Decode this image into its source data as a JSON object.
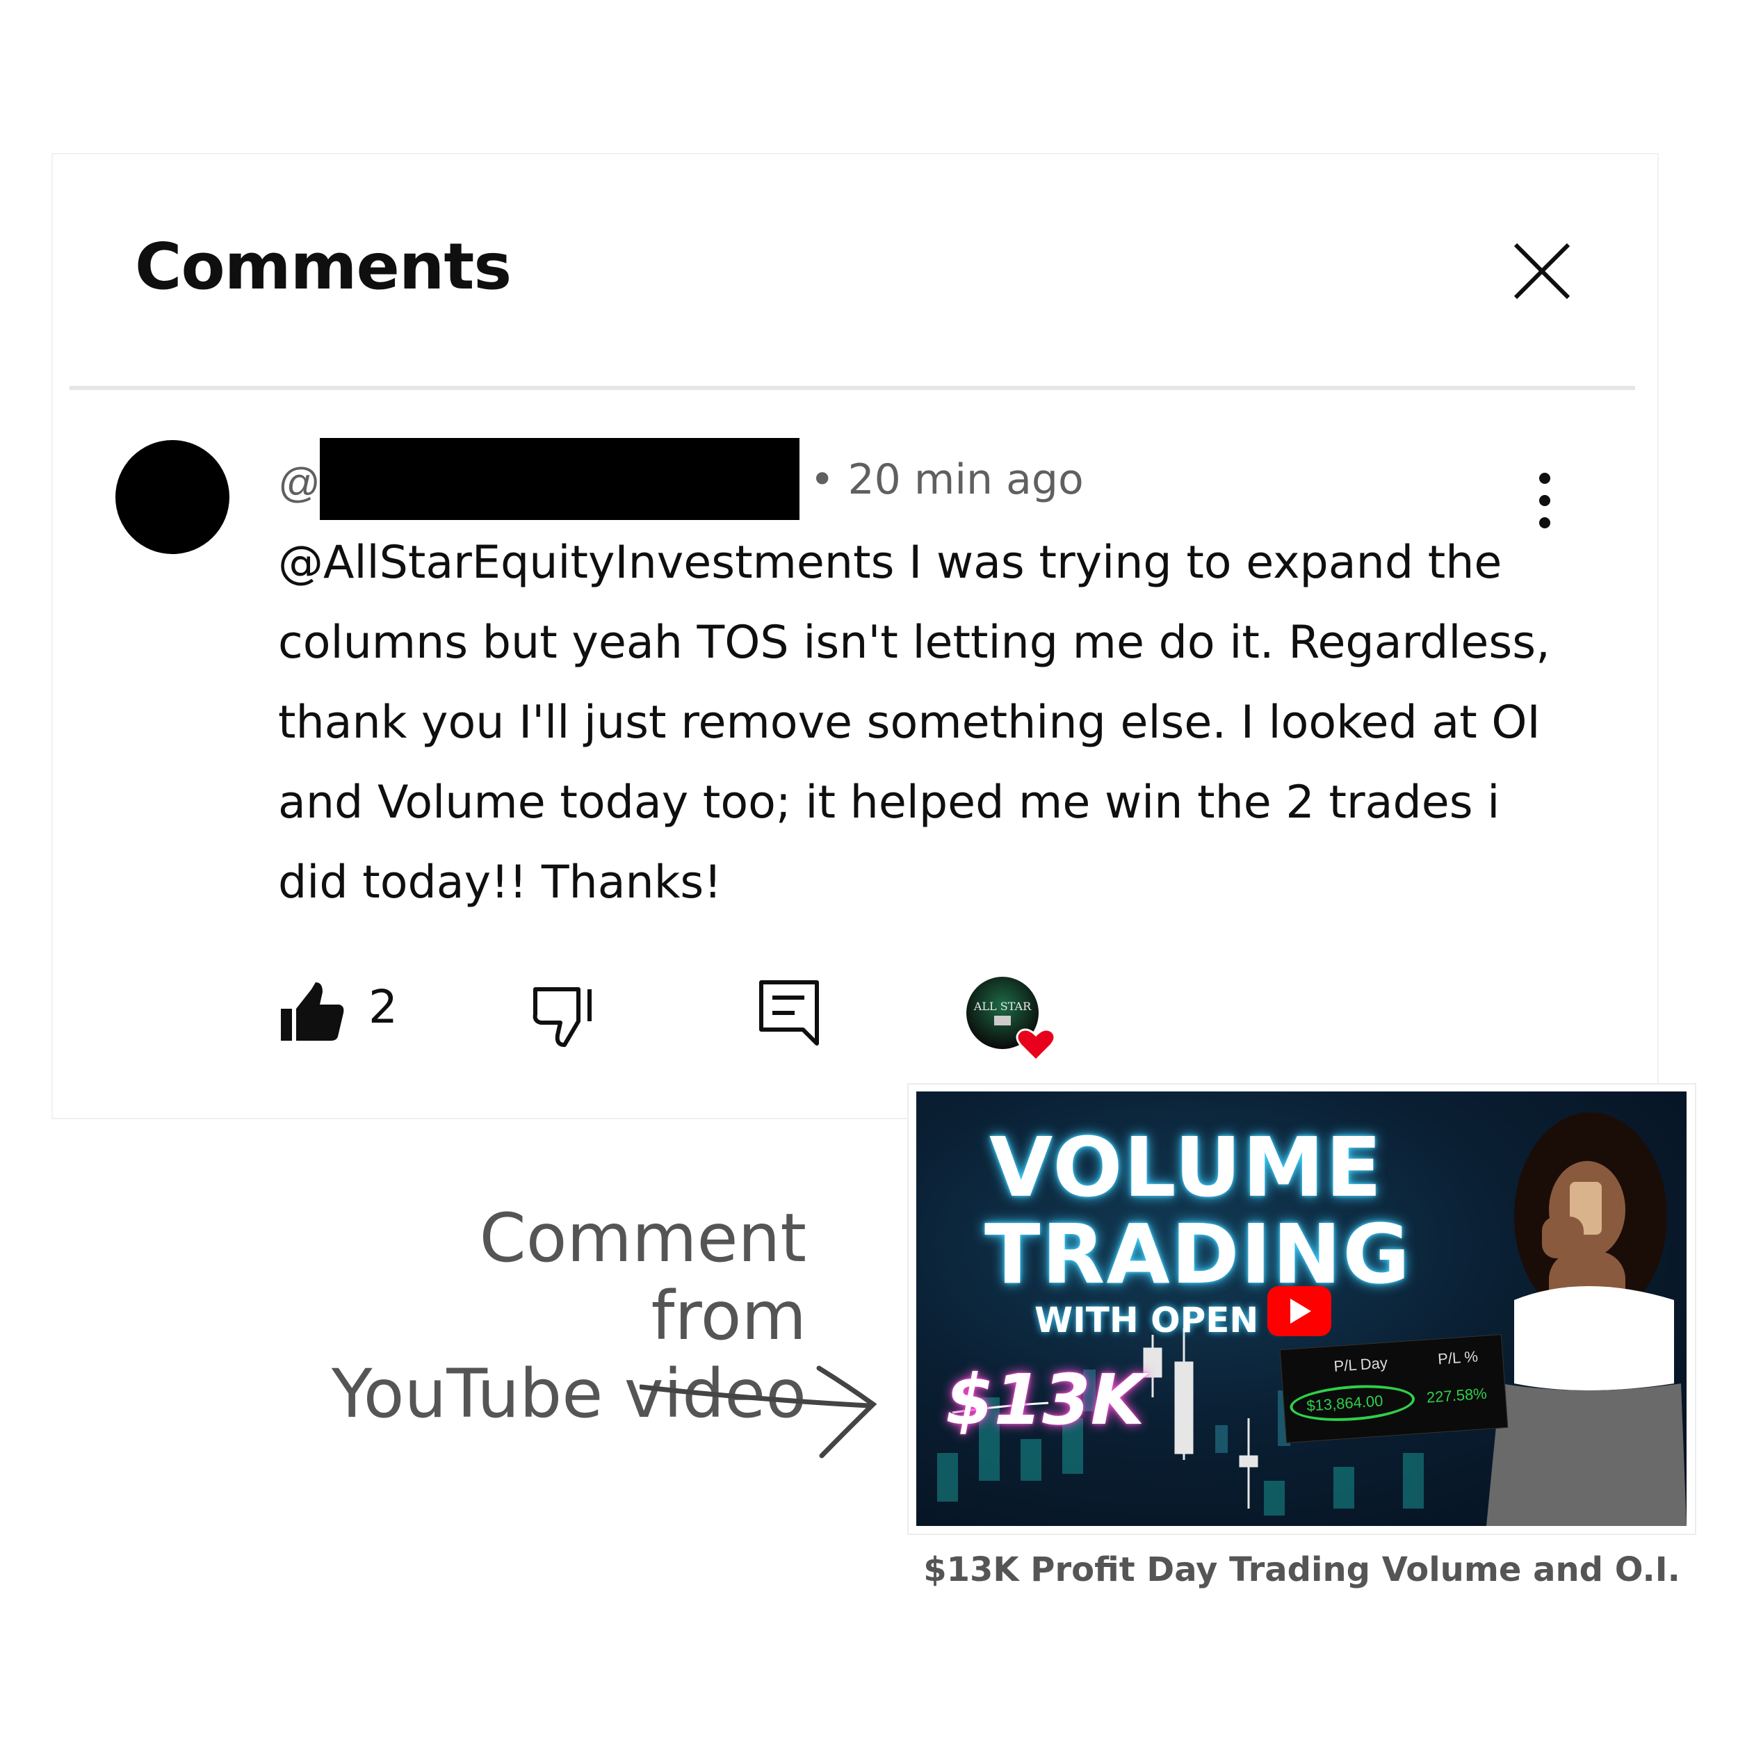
{
  "panel": {
    "title": "Comments"
  },
  "comment": {
    "handle_prefix": "@",
    "meta": "• 20 min ago",
    "text": "@AllStarEquityInvestments I was trying to expand the columns but yeah TOS isn't letting me do it. Regardless, thank you I'll just remove something else. I looked at OI and Volume today too; it helped me win the 2 trades i did today!! Thanks!",
    "likes": "2",
    "creator_heart_logo_text": "ALL STAR"
  },
  "side_caption": {
    "line1": "Comment from",
    "line2": "YouTube video"
  },
  "thumbnail": {
    "line1": "VOLUME",
    "line2": "TRADING",
    "line3": "WITH OPEN I",
    "amount": "$13K",
    "pl_day_label": "P/L Day",
    "pl_pct_label": "P/L %",
    "pl_day_value": "$13,864.00",
    "pl_pct_value": "227.58%"
  },
  "video_title": "$13K Profit Day Trading Volume and O.I.",
  "colors": {
    "heart": "#e8001c",
    "play": "#ff0000",
    "glow": "#3fd0ff",
    "gain": "#2fd04a"
  }
}
